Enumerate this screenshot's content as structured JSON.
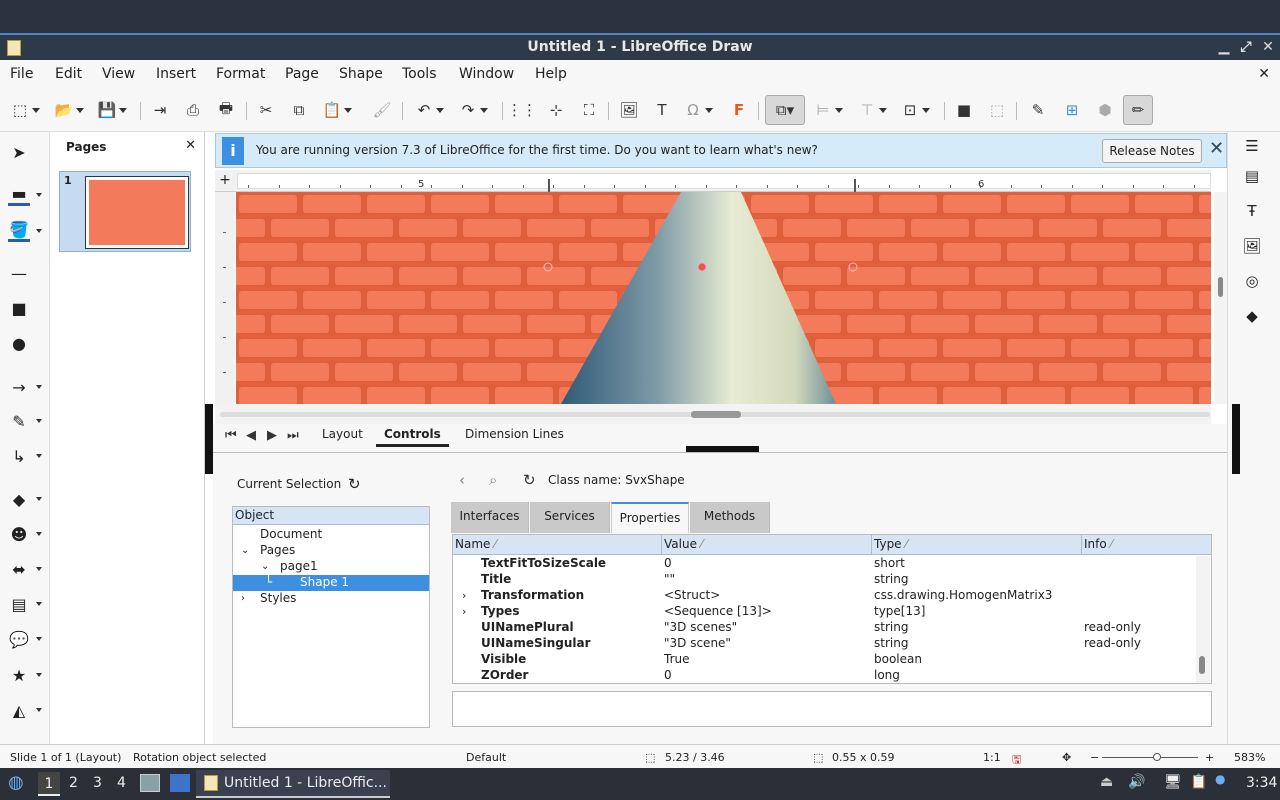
{
  "window": {
    "title": "Untitled 1 - LibreOffice Draw"
  },
  "menu": [
    "File",
    "Edit",
    "View",
    "Insert",
    "Format",
    "Page",
    "Shape",
    "Tools",
    "Window",
    "Help"
  ],
  "pages_panel": {
    "title": "Pages",
    "page_number": "1"
  },
  "infobar": {
    "message": "You are running version 7.3 of LibreOffice for the first time. Do you want to learn what's new?",
    "button": "Release Notes"
  },
  "ruler": {
    "labels": [
      "5",
      "6"
    ]
  },
  "layer_tabs": [
    "Layout",
    "Controls",
    "Dimension Lines"
  ],
  "inspector": {
    "current_selection": "Current Selection",
    "class_label": "Class name:",
    "class_name": "SvxShape",
    "tree_header": "Object",
    "tree": [
      "Document",
      "Pages",
      "page1",
      "Shape 1",
      "Styles"
    ],
    "tabs": [
      "Interfaces",
      "Services",
      "Properties",
      "Methods"
    ],
    "columns": [
      "Name",
      "Value",
      "Type",
      "Info"
    ],
    "rows": [
      {
        "name": "TextFitToSizeScale",
        "value": "0",
        "type": "short",
        "info": ""
      },
      {
        "name": "Title",
        "value": "\"\"",
        "type": "string",
        "info": ""
      },
      {
        "name": "Transformation",
        "value": "<Struct>",
        "type": "css.drawing.HomogenMatrix3",
        "info": ""
      },
      {
        "name": "Types",
        "value": "<Sequence [13]>",
        "type": "type[13]",
        "info": ""
      },
      {
        "name": "UINamePlural",
        "value": "\"3D scenes\"",
        "type": "string",
        "info": "read-only"
      },
      {
        "name": "UINameSingular",
        "value": "\"3D scene\"",
        "type": "string",
        "info": "read-only"
      },
      {
        "name": "Visible",
        "value": "True",
        "type": "boolean",
        "info": ""
      },
      {
        "name": "ZOrder",
        "value": "0",
        "type": "long",
        "info": ""
      }
    ]
  },
  "status": {
    "slide": "Slide 1 of 1 (Layout)",
    "selection": "Rotation object selected",
    "style": "Default",
    "position": "5.23 / 3.46",
    "size": "0.55 x 0.59",
    "scale": "1:1",
    "zoom_minus": "−",
    "zoom_plus": "+",
    "zoom": "583%"
  },
  "taskbar": {
    "workspaces": [
      "1",
      "2",
      "3",
      "4"
    ],
    "task": "Untitled 1 - LibreOffic...",
    "clock": "3:34"
  },
  "colors": {
    "accent": "#3d8fe0",
    "brick": "#f47a5c",
    "mortar": "#e05f3c"
  }
}
